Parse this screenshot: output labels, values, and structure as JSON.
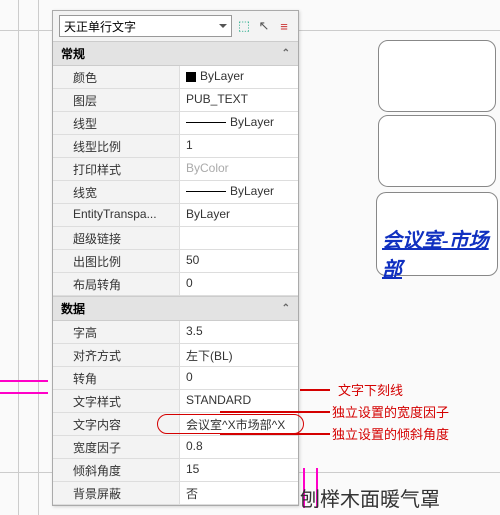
{
  "toolbar": {
    "object_type": "天正单行文字"
  },
  "sections": {
    "general": "常规",
    "data": "数据"
  },
  "props": {
    "color": {
      "label": "颜色",
      "value": "ByLayer"
    },
    "layer": {
      "label": "图层",
      "value": "PUB_TEXT"
    },
    "linetype": {
      "label": "线型",
      "value": "ByLayer"
    },
    "ltscale": {
      "label": "线型比例",
      "value": "1"
    },
    "plotstyle": {
      "label": "打印样式",
      "value": "ByColor"
    },
    "lineweight": {
      "label": "线宽",
      "value": "ByLayer"
    },
    "transparency": {
      "label": "EntityTranspa...",
      "value": "ByLayer"
    },
    "hyperlink": {
      "label": "超级链接",
      "value": ""
    },
    "plotscale": {
      "label": "出图比例",
      "value": "50"
    },
    "layoutrot": {
      "label": "布局转角",
      "value": "0"
    }
  },
  "dataProps": {
    "textheight": {
      "label": "字高",
      "value": "3.5"
    },
    "align": {
      "label": "对齐方式",
      "value": "左下(BL)"
    },
    "rotation": {
      "label": "转角",
      "value": "0"
    },
    "textstyle": {
      "label": "文字样式",
      "value": "STANDARD"
    },
    "content": {
      "label": "文字内容",
      "value": "会议室^X市场部^X"
    },
    "widthfactor": {
      "label": "宽度因子",
      "value": "0.8"
    },
    "oblique": {
      "label": "倾斜角度",
      "value": "15"
    },
    "bgmask": {
      "label": "背景屏蔽",
      "value": "否"
    }
  },
  "annotations": {
    "underline": "文字下刻线",
    "width": "独立设置的宽度因子",
    "oblique": "独立设置的倾斜角度"
  },
  "canvas": {
    "room_label": "会议室-市场部",
    "bottom_text": "刨榉木面暖气罩"
  }
}
